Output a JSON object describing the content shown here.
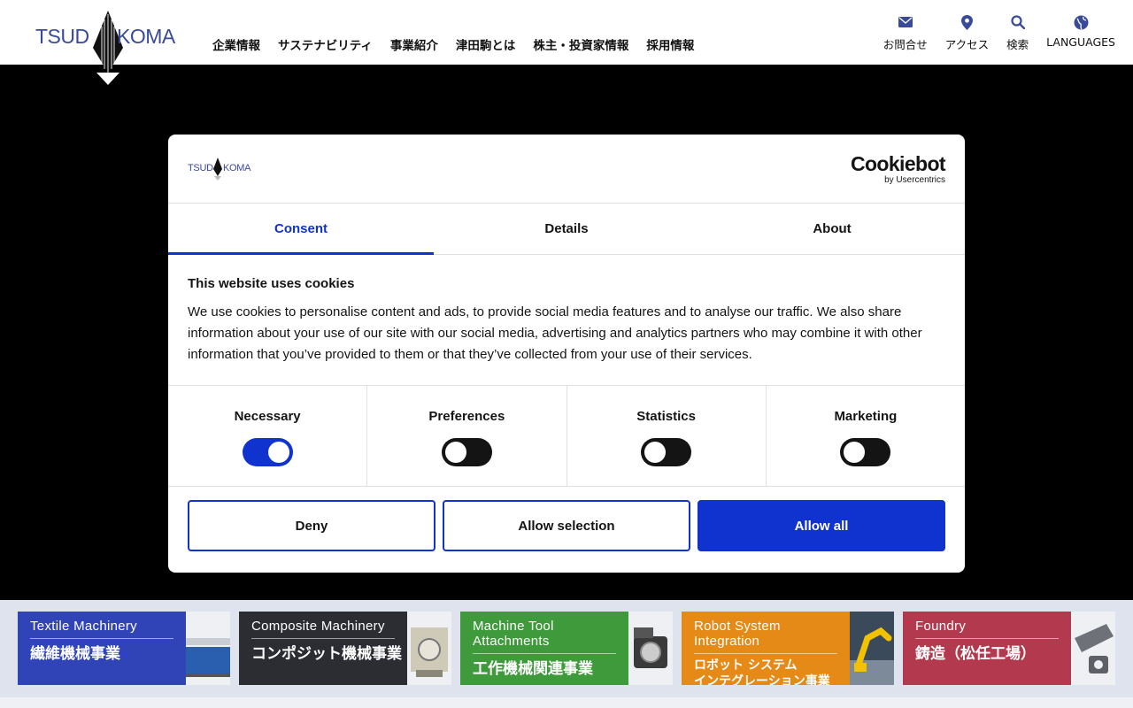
{
  "header": {
    "logo_left": "TSUD",
    "logo_right": "KOMA",
    "nav": [
      {
        "label": "企業情報"
      },
      {
        "label": "サステナビリティ"
      },
      {
        "label": "事業紹介"
      },
      {
        "label": "津田駒とは"
      },
      {
        "label": "株主・投資家情報"
      },
      {
        "label": "採用情報"
      }
    ],
    "util": [
      {
        "label": "お問合せ",
        "icon": "mail-icon"
      },
      {
        "label": "アクセス",
        "icon": "map-pin-icon"
      },
      {
        "label": "検索",
        "icon": "search-icon"
      },
      {
        "label": "LANGUAGES",
        "icon": "globe-icon"
      }
    ],
    "brand_color": "#3a4a9a"
  },
  "dialog": {
    "logo_left": "TSUD",
    "logo_right": "KOMA",
    "cookiebot_main": "Cookiebot",
    "cookiebot_sub": "by Usercentrics",
    "tabs": [
      {
        "label": "Consent",
        "active": true
      },
      {
        "label": "Details",
        "active": false
      },
      {
        "label": "About",
        "active": false
      }
    ],
    "title": "This website uses cookies",
    "text": "We use cookies to personalise content and ads, to provide social media features and to analyse our traffic. We also share information about your use of our site with our social media, advertising and analytics partners who may combine it with other information that you’ve provided to them or that they’ve collected from your use of their services.",
    "categories": [
      {
        "label": "Necessary",
        "on": true
      },
      {
        "label": "Preferences",
        "on": false
      },
      {
        "label": "Statistics",
        "on": false
      },
      {
        "label": "Marketing",
        "on": false
      }
    ],
    "buttons": {
      "deny": "Deny",
      "allow_selection": "Allow selection",
      "allow_all": "Allow all"
    },
    "accent_color": "#1032cf"
  },
  "banners": [
    {
      "en": "Textile Machinery",
      "jp": "繊維機械事業",
      "color": "#3044b8"
    },
    {
      "en": "Composite Machinery",
      "jp": "コンポジット機械事業",
      "color": "#2c2d33"
    },
    {
      "en": "Machine Tool Attachments",
      "jp": "工作機械関連事業",
      "color": "#3e9a3a"
    },
    {
      "en": "Robot System Integration",
      "jp": "ロボット システム\nインテグレーション事業",
      "color": "#e58a16"
    },
    {
      "en": "Foundry",
      "jp": "鋳造（松任工場）",
      "color": "#b33a4e"
    }
  ]
}
